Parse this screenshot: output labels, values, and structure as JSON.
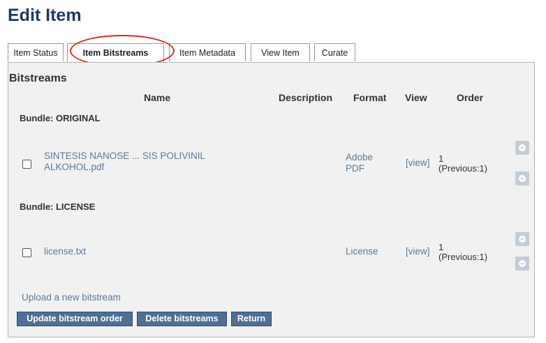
{
  "page_title": "Edit Item",
  "tabs": [
    {
      "label": "Item Status"
    },
    {
      "label": "Item Bitstreams"
    },
    {
      "label": "Item Metadata"
    },
    {
      "label": "View Item"
    },
    {
      "label": "Curate"
    }
  ],
  "active_tab": "Item Bitstreams",
  "panel_heading": "Bitstreams",
  "columns": {
    "name": "Name",
    "description": "Description",
    "format": "Format",
    "view": "View",
    "order": "Order"
  },
  "bundles": [
    {
      "label": "Bundle: ORIGINAL",
      "items": [
        {
          "name_line1": "SINTESIS NANOSE ... SIS POLIVINIL",
          "name_line2": "ALKOHOL.pdf",
          "format_line1": "Adobe",
          "format_line2": "PDF",
          "view": "[view]",
          "order_line1": "1",
          "order_line2": "(Previous:1)"
        }
      ]
    },
    {
      "label": "Bundle: LICENSE",
      "items": [
        {
          "name_line1": "license.txt",
          "format_line1": "License",
          "view": "[view]",
          "order_line1": "1",
          "order_line2": "(Previous:1)"
        }
      ]
    }
  ],
  "upload_link": "Upload a new bitstream",
  "buttons": {
    "update_order": "Update bitstream order",
    "delete": "Delete bitstreams",
    "return": "Return"
  },
  "colors": {
    "title": "#1f3b5a",
    "link": "#5b7a9a",
    "button_bg": "#4f6f94",
    "highlight": "#d9261c",
    "arrow_button": "#c3cdd7"
  }
}
